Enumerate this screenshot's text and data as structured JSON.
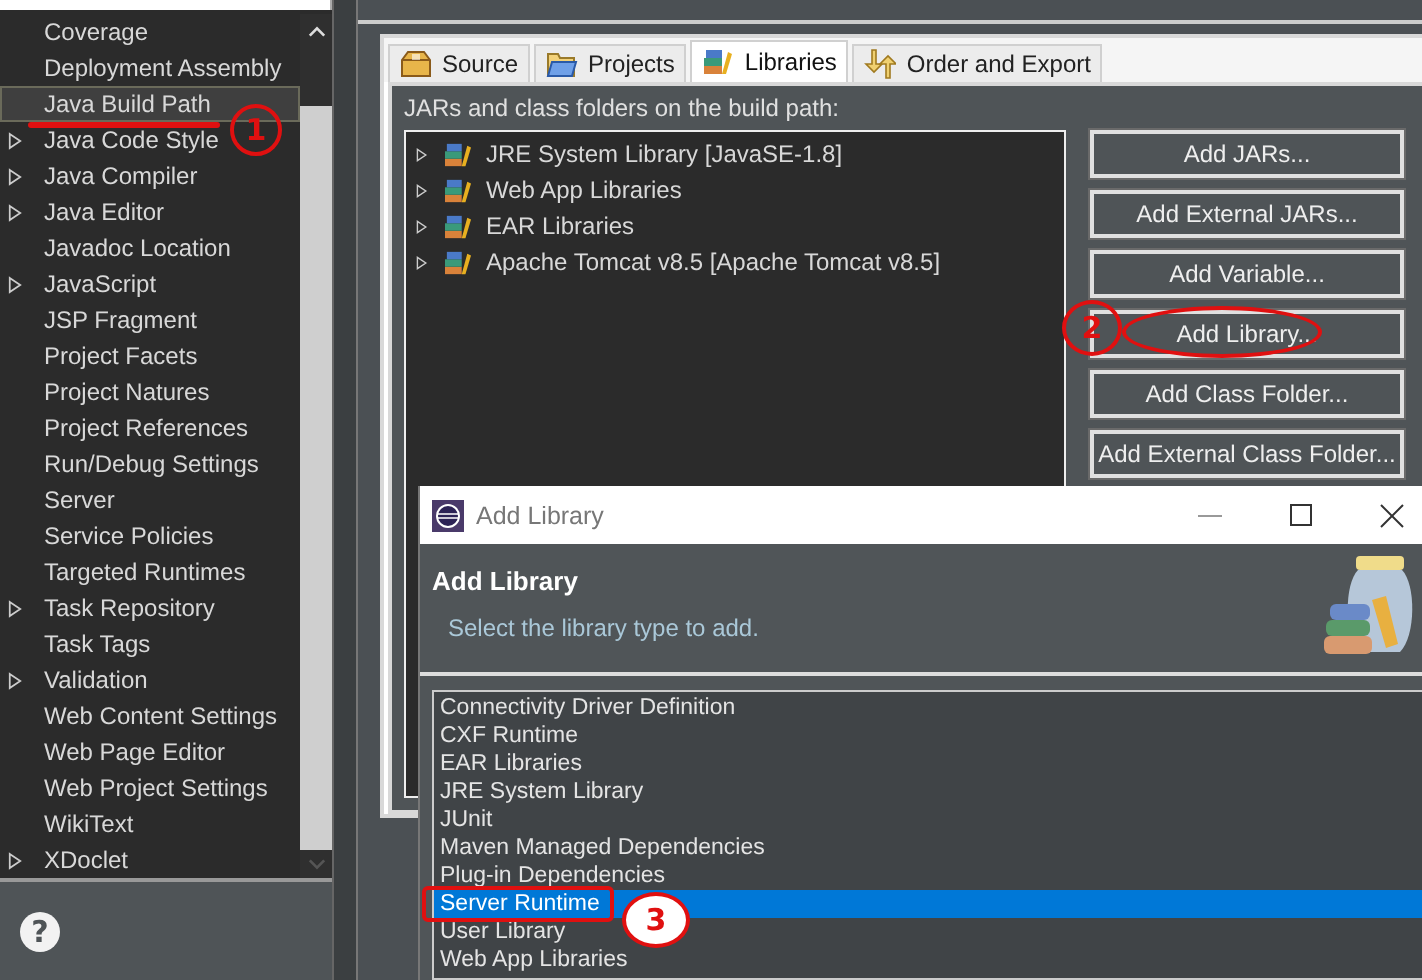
{
  "sidebar": {
    "items": [
      {
        "label": "Coverage",
        "expandable": false,
        "selected": false
      },
      {
        "label": "Deployment Assembly",
        "expandable": false,
        "selected": false
      },
      {
        "label": "Java Build Path",
        "expandable": false,
        "selected": true
      },
      {
        "label": "Java Code Style",
        "expandable": true,
        "selected": false
      },
      {
        "label": "Java Compiler",
        "expandable": true,
        "selected": false
      },
      {
        "label": "Java Editor",
        "expandable": true,
        "selected": false
      },
      {
        "label": "Javadoc Location",
        "expandable": false,
        "selected": false
      },
      {
        "label": "JavaScript",
        "expandable": true,
        "selected": false
      },
      {
        "label": "JSP Fragment",
        "expandable": false,
        "selected": false
      },
      {
        "label": "Project Facets",
        "expandable": false,
        "selected": false
      },
      {
        "label": "Project Natures",
        "expandable": false,
        "selected": false
      },
      {
        "label": "Project References",
        "expandable": false,
        "selected": false
      },
      {
        "label": "Run/Debug Settings",
        "expandable": false,
        "selected": false
      },
      {
        "label": "Server",
        "expandable": false,
        "selected": false
      },
      {
        "label": "Service Policies",
        "expandable": false,
        "selected": false
      },
      {
        "label": "Targeted Runtimes",
        "expandable": false,
        "selected": false
      },
      {
        "label": "Task Repository",
        "expandable": true,
        "selected": false
      },
      {
        "label": "Task Tags",
        "expandable": false,
        "selected": false
      },
      {
        "label": "Validation",
        "expandable": true,
        "selected": false
      },
      {
        "label": "Web Content Settings",
        "expandable": false,
        "selected": false
      },
      {
        "label": "Web Page Editor",
        "expandable": false,
        "selected": false
      },
      {
        "label": "Web Project Settings",
        "expandable": false,
        "selected": false
      },
      {
        "label": "WikiText",
        "expandable": false,
        "selected": false
      },
      {
        "label": "XDoclet",
        "expandable": true,
        "selected": false
      }
    ]
  },
  "help_button": {
    "label": "?"
  },
  "tabs": [
    {
      "label": "Source",
      "selected": false
    },
    {
      "label": "Projects",
      "selected": false
    },
    {
      "label": "Libraries",
      "selected": true
    },
    {
      "label": "Order and Export",
      "selected": false
    }
  ],
  "build_path": {
    "caption": "JARs and class folders on the build path:",
    "entries": [
      {
        "label": "JRE System Library [JavaSE-1.8]",
        "expanded": false
      },
      {
        "label": "Web App Libraries",
        "expanded": false
      },
      {
        "label": "EAR Libraries",
        "expanded": false
      },
      {
        "label": "Apache Tomcat v8.5 [Apache Tomcat v8.5]",
        "expanded": false
      }
    ],
    "buttons": [
      "Add JARs...",
      "Add External JARs...",
      "Add Variable...",
      "Add Library...",
      "Add Class Folder...",
      "Add External Class Folder..."
    ]
  },
  "dialog": {
    "title": "Add Library",
    "heading": "Add Library",
    "description": "Select the library type to add.",
    "library_types": [
      {
        "label": "Connectivity Driver Definition",
        "selected": false
      },
      {
        "label": "CXF Runtime",
        "selected": false
      },
      {
        "label": "EAR Libraries",
        "selected": false
      },
      {
        "label": "JRE System Library",
        "selected": false
      },
      {
        "label": "JUnit",
        "selected": false
      },
      {
        "label": "Maven Managed Dependencies",
        "selected": false
      },
      {
        "label": "Plug-in Dependencies",
        "selected": false
      },
      {
        "label": "Server Runtime",
        "selected": true
      },
      {
        "label": "User Library",
        "selected": false
      },
      {
        "label": "Web App Libraries",
        "selected": false
      }
    ]
  },
  "annotations": [
    {
      "label": "1"
    },
    {
      "label": "2"
    },
    {
      "label": "3"
    }
  ]
}
